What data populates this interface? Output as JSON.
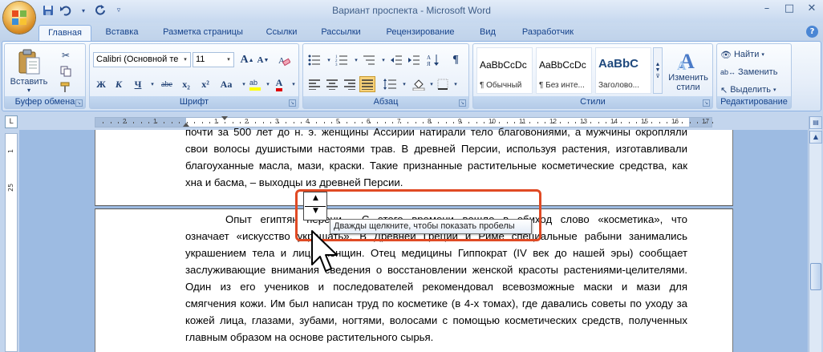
{
  "window": {
    "title": "Вариант проспекта - Microsoft Word",
    "controls": [
      "–",
      "□",
      "✕"
    ]
  },
  "qat": {
    "icons": [
      "save-icon",
      "undo-icon",
      "redo-icon",
      "customize-icon"
    ]
  },
  "tabs": [
    {
      "label": "Главная",
      "active": true
    },
    {
      "label": "Вставка"
    },
    {
      "label": "Разметка страницы"
    },
    {
      "label": "Ссылки"
    },
    {
      "label": "Рассылки"
    },
    {
      "label": "Рецензирование"
    },
    {
      "label": "Вид"
    },
    {
      "label": "Разработчик"
    }
  ],
  "ribbon": {
    "clipboard": {
      "label": "Буфер обмена",
      "paste_label": "Вставить"
    },
    "font": {
      "label": "Шрифт",
      "font_name": "Calibri (Основной те",
      "font_size": "11",
      "bold": "Ж",
      "italic": "К",
      "underline": "Ч",
      "strike": "abe",
      "sub": "x₂",
      "sup": "x²",
      "case": "Aa",
      "grow": "A",
      "shrink": "A",
      "color_a": "A"
    },
    "paragraph": {
      "label": "Абзац"
    },
    "styles": {
      "label": "Стили",
      "items": [
        {
          "sample": "AaBbCcDc",
          "name": "¶ Обычный"
        },
        {
          "sample": "AaBbCcDc",
          "name": "¶ Без инте..."
        },
        {
          "sample": "AaBbC",
          "name": "Заголово..."
        }
      ],
      "change_label_1": "Изменить",
      "change_label_2": "стили"
    },
    "editing": {
      "label": "Редактирование",
      "find": "Найти",
      "replace": "Заменить",
      "select": "Выделить"
    }
  },
  "ruler": {
    "labels": [
      "3",
      "2",
      "1",
      "1",
      "2",
      "3",
      "4",
      "5",
      "6",
      "7",
      "8",
      "9",
      "10",
      "11",
      "12",
      "13",
      "14",
      "15",
      "16",
      "17"
    ],
    "vlabels": [
      "1",
      "25"
    ]
  },
  "document": {
    "page1_lines": [
      "почти за 500 лет до н. э. женщины Ассирии натирали тело благовониями, а мужчины окропляли",
      "свои волосы душистыми настоями трав. В древней Персии, используя растения, изготавливали",
      "благоуханные масла, мази, краски. Такие признанные растительные косметические средства, как",
      "хна и басма, – выходцы из древней Персии."
    ],
    "page2_lines": [
      "Опыт египтян перени               . С этого времени вошло в обиход слово «косметика», что",
      "означает «искусство украшать». В Древней Греции и Риме специальные рабыни занимались",
      "украшением тела и лица женщин. Отец медицины Гиппократ (IV век до нашей эры) сообщает",
      "заслуживающие внимания сведения о восстановлении женской красоты растениями-целителями.",
      "Один из его учеников и последователей рекомендовал всевозможные маски и мази для",
      "смягчения кожи. Им был написан труд по косметике (в 4-х томах), где давались советы по уходу за",
      "кожей лица, глазами, зубами, ногтями, волосами с помощью косметических средств, полученных",
      "главным образом на основе растительного сырья."
    ]
  },
  "tooltip": {
    "text": "Дважды щелкните, чтобы показать пробелы"
  },
  "colors": {
    "highlight": "#e04a24",
    "ribbon_border": "#8db2e3",
    "doc_bg": "#9dbbe2"
  }
}
